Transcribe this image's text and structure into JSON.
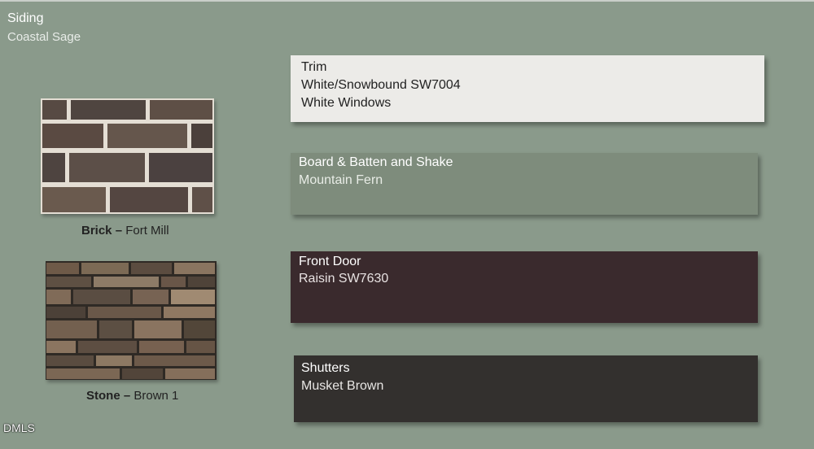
{
  "siding": {
    "title": "Siding",
    "color": "Coastal Sage"
  },
  "swatches": {
    "trim": {
      "title": "Trim",
      "line1": "White/Snowbound SW7004",
      "line2": "White Windows",
      "color": "#ecebe8"
    },
    "board": {
      "title": "Board & Batten and Shake",
      "line1": "Mountain Fern",
      "color": "#7e8c7c"
    },
    "door": {
      "title": "Front Door",
      "line1": "Raisin SW7630",
      "color": "#3a2a2d"
    },
    "shutters": {
      "title": "Shutters",
      "line1": "Musket Brown",
      "color": "#33302e"
    }
  },
  "materials": {
    "brick": {
      "label": "Brick –",
      "name": "Fort Mill"
    },
    "stone": {
      "label": "Stone –",
      "name": "Brown 1"
    }
  },
  "watermark": "DMLS"
}
